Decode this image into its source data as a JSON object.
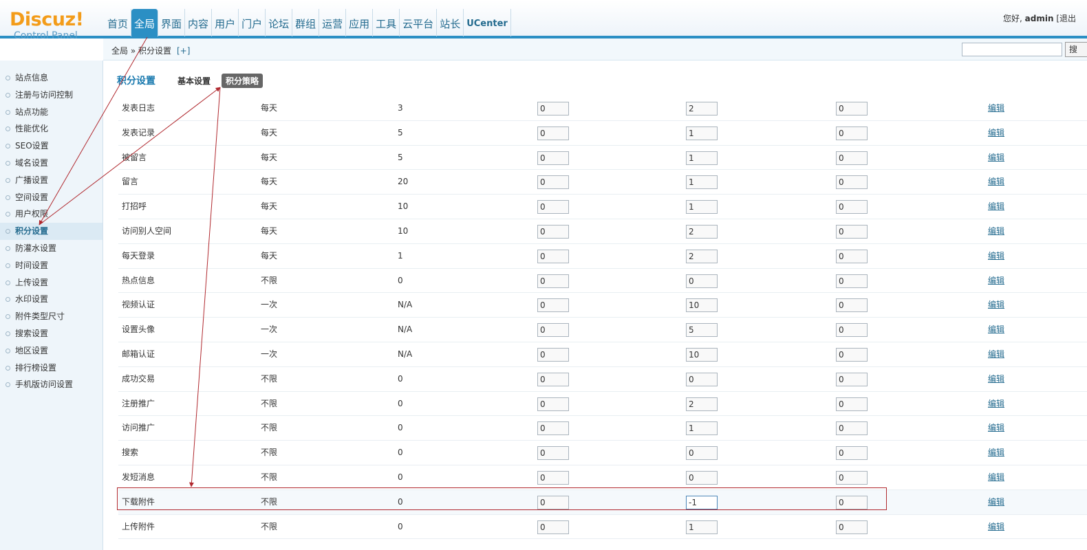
{
  "header": {
    "logo_text": "Discuz!",
    "logo_subtext": "Control Panel",
    "nav": [
      "首页",
      "全局",
      "界面",
      "内容",
      "用户",
      "门户",
      "论坛",
      "群组",
      "运营",
      "应用",
      "工具",
      "云平台",
      "站长",
      "UCenter"
    ],
    "active_nav": "全局",
    "greeting_prefix": "您好,",
    "username": "admin",
    "logout_label": "[退出"
  },
  "breadcrumb": {
    "text": "全局 » 积分设置",
    "plus": "[+]",
    "search_label": "搜"
  },
  "sidebar": {
    "items": [
      "站点信息",
      "注册与访问控制",
      "站点功能",
      "性能优化",
      "SEO设置",
      "域名设置",
      "广播设置",
      "空间设置",
      "用户权限",
      "积分设置",
      "防灌水设置",
      "时间设置",
      "上传设置",
      "水印设置",
      "附件类型尺寸",
      "搜索设置",
      "地区设置",
      "排行榜设置",
      "手机版访问设置"
    ],
    "active": "积分设置"
  },
  "main": {
    "title": "积分设置",
    "tabs": [
      "基本设置",
      "积分策略"
    ],
    "active_tab": "积分策略",
    "edit_label": "编辑",
    "rows": [
      {
        "name": "发表日志",
        "cycle": "每天",
        "count": "3",
        "v1": "0",
        "v2": "2",
        "v3": "0"
      },
      {
        "name": "发表记录",
        "cycle": "每天",
        "count": "5",
        "v1": "0",
        "v2": "1",
        "v3": "0"
      },
      {
        "name": "被留言",
        "cycle": "每天",
        "count": "5",
        "v1": "0",
        "v2": "1",
        "v3": "0"
      },
      {
        "name": "留言",
        "cycle": "每天",
        "count": "20",
        "v1": "0",
        "v2": "1",
        "v3": "0"
      },
      {
        "name": "打招呼",
        "cycle": "每天",
        "count": "10",
        "v1": "0",
        "v2": "1",
        "v3": "0"
      },
      {
        "name": "访问别人空间",
        "cycle": "每天",
        "count": "10",
        "v1": "0",
        "v2": "2",
        "v3": "0"
      },
      {
        "name": "每天登录",
        "cycle": "每天",
        "count": "1",
        "v1": "0",
        "v2": "2",
        "v3": "0"
      },
      {
        "name": "热点信息",
        "cycle": "不限",
        "count": "0",
        "v1": "0",
        "v2": "0",
        "v3": "0"
      },
      {
        "name": "视频认证",
        "cycle": "一次",
        "count": "N/A",
        "v1": "0",
        "v2": "10",
        "v3": "0"
      },
      {
        "name": "设置头像",
        "cycle": "一次",
        "count": "N/A",
        "v1": "0",
        "v2": "5",
        "v3": "0"
      },
      {
        "name": "邮箱认证",
        "cycle": "一次",
        "count": "N/A",
        "v1": "0",
        "v2": "10",
        "v3": "0"
      },
      {
        "name": "成功交易",
        "cycle": "不限",
        "count": "0",
        "v1": "0",
        "v2": "0",
        "v3": "0"
      },
      {
        "name": "注册推广",
        "cycle": "不限",
        "count": "0",
        "v1": "0",
        "v2": "2",
        "v3": "0"
      },
      {
        "name": "访问推广",
        "cycle": "不限",
        "count": "0",
        "v1": "0",
        "v2": "1",
        "v3": "0"
      },
      {
        "name": "搜索",
        "cycle": "不限",
        "count": "0",
        "v1": "0",
        "v2": "0",
        "v3": "0"
      },
      {
        "name": "发短消息",
        "cycle": "不限",
        "count": "0",
        "v1": "0",
        "v2": "0",
        "v3": "0"
      },
      {
        "name": "下载附件",
        "cycle": "不限",
        "count": "0",
        "v1": "0",
        "v2": "-1",
        "v3": "0"
      },
      {
        "name": "上传附件",
        "cycle": "不限",
        "count": "0",
        "v1": "0",
        "v2": "1",
        "v3": "0"
      }
    ],
    "highlighted_row": "下载附件"
  },
  "colors": {
    "accent": "#2b8fc4",
    "annotation": "#b0282e",
    "logo": "#f39c1a"
  }
}
